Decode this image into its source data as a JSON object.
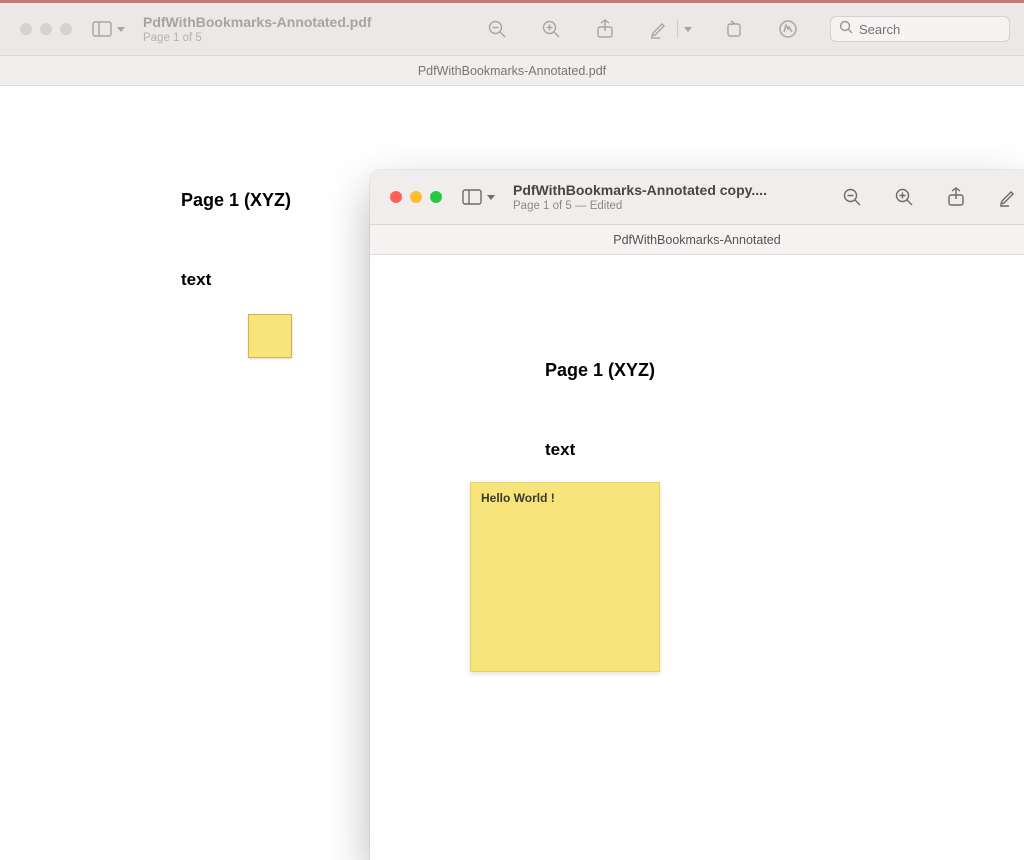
{
  "back_window": {
    "title": "PdfWithBookmarks-Annotated.pdf",
    "subtitle": "Page 1 of 5",
    "tab_label": "PdfWithBookmarks-Annotated.pdf",
    "search_placeholder": "Search",
    "page": {
      "heading": "Page 1 (XYZ)",
      "text": "text"
    }
  },
  "front_window": {
    "title": "PdfWithBookmarks-Annotated copy....",
    "subtitle": "Page 1 of 5 — Edited",
    "tab_label": "PdfWithBookmarks-Annotated",
    "page": {
      "heading": "Page 1 (XYZ)",
      "text": "text",
      "note_text": "Hello World !"
    }
  }
}
